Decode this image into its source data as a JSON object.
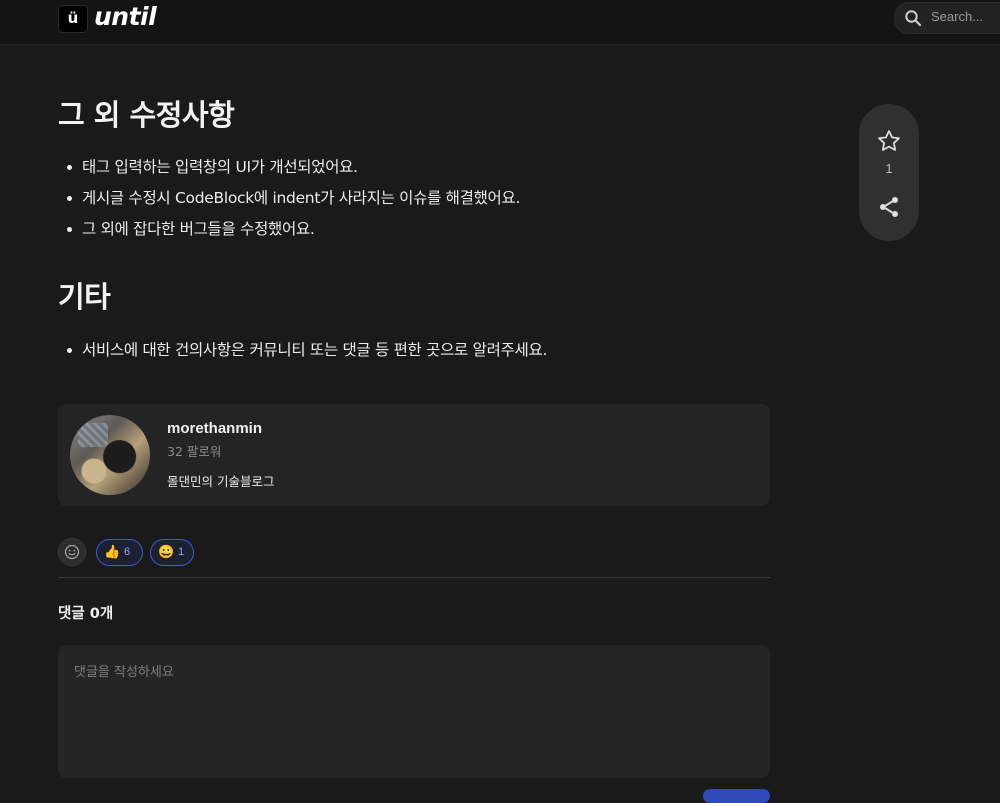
{
  "header": {
    "logo_badge": "ü",
    "logo_text": "until",
    "search_placeholder": "Search..."
  },
  "sections": [
    {
      "heading": "그 외 수정사항",
      "items": [
        "태그 입력하는 입력창의 UI가 개선되었어요.",
        "게시글 수정시 CodeBlock에 indent가 사라지는 이슈를 해결했어요.",
        "그 외에 잡다한 버그들을 수정했어요."
      ]
    },
    {
      "heading": "기타",
      "items": [
        "서비스에 대한 건의사항은 커뮤니티 또는 댓글 등 편한 곳으로 알려주세요."
      ]
    }
  ],
  "floating_panel": {
    "like_count": "1",
    "icons": [
      "star-icon",
      "share-icon"
    ]
  },
  "author": {
    "name": "morethanmin",
    "followers": "32 팔로워",
    "bio": "몰댄민의 기술블로그"
  },
  "reactions": [
    {
      "emoji": "👍",
      "count": "6"
    },
    {
      "emoji": "😀",
      "count": "1"
    }
  ],
  "comments": {
    "title": "댓글 0개",
    "placeholder": "댓글을 작성하세요"
  },
  "colors": {
    "background": "#1a1a1a",
    "header": "#141414",
    "accent": "#3b5bd9",
    "card": "#242424"
  }
}
